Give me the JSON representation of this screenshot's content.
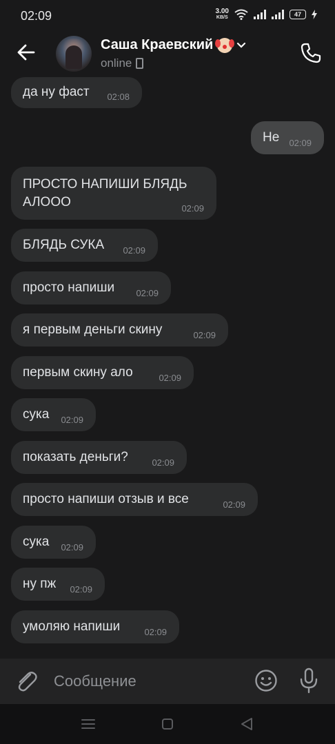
{
  "status_bar": {
    "time": "02:09",
    "net_speed_value": "3.00",
    "net_speed_unit": "KB/S",
    "battery": "47"
  },
  "header": {
    "name": "Саша Краевский",
    "status": "online"
  },
  "messages": [
    {
      "text": "да ну  фаст",
      "time": "02:08",
      "dir": "in"
    },
    {
      "text": "Не",
      "time": "02:09",
      "dir": "out"
    },
    {
      "text": "ПРОСТО НАПИШИ БЛЯДЬ АЛООО",
      "time": "02:09",
      "dir": "in"
    },
    {
      "text": "БЛЯДЬ СУКА",
      "time": "02:09",
      "dir": "in"
    },
    {
      "text": "просто напиши",
      "time": "02:09",
      "dir": "in"
    },
    {
      "text": "я первым деньги скину",
      "time": "02:09",
      "dir": "in"
    },
    {
      "text": "первым скину ало",
      "time": "02:09",
      "dir": "in"
    },
    {
      "text": "сука",
      "time": "02:09",
      "dir": "in"
    },
    {
      "text": "показать деньги?",
      "time": "02:09",
      "dir": "in"
    },
    {
      "text": "просто напиши отзыв и все",
      "time": "02:09",
      "dir": "in"
    },
    {
      "text": "сука",
      "time": "02:09",
      "dir": "in"
    },
    {
      "text": "ну пж",
      "time": "02:09",
      "dir": "in"
    },
    {
      "text": "умоляю напиши",
      "time": "02:09",
      "dir": "in"
    }
  ],
  "composer": {
    "placeholder": "Сообщение"
  },
  "icons": {
    "back": "arrow-left-icon",
    "call": "phone-icon",
    "attach": "paperclip-icon",
    "emoji": "smile-icon",
    "mic": "microphone-icon"
  },
  "colors": {
    "background": "#19191a",
    "bubble_in": "#2c2d2e",
    "bubble_out": "#454647",
    "text": "#e1e3e6",
    "muted": "#8a8c90"
  }
}
